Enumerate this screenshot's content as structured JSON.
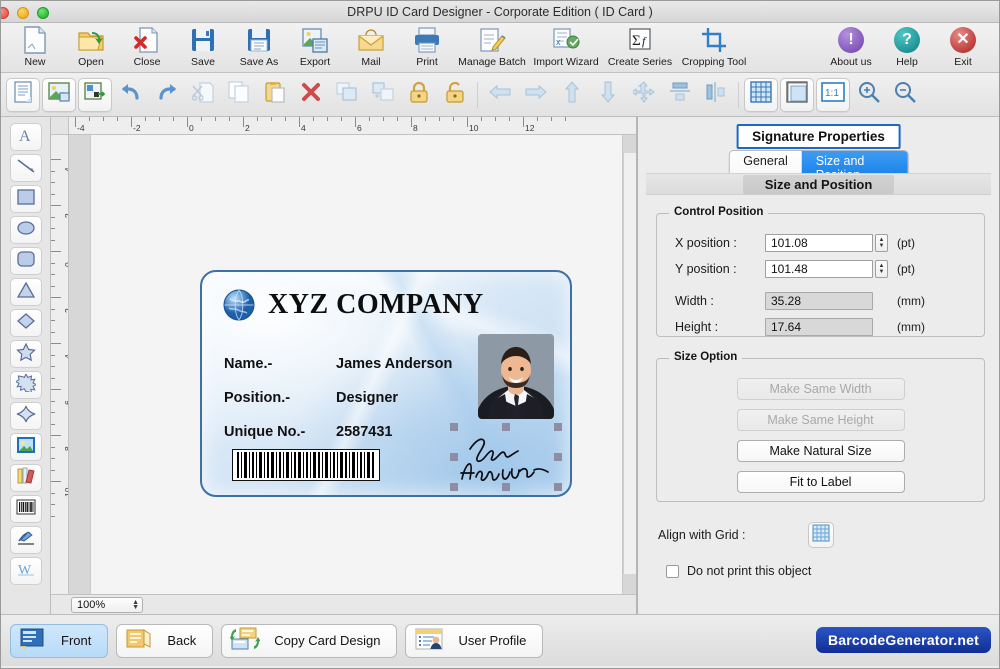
{
  "window": {
    "title": "DRPU ID Card Designer - Corporate Edition ( ID Card )",
    "traffic_lights": [
      "close",
      "minimize",
      "zoom"
    ]
  },
  "toolbar_main": {
    "items": [
      {
        "label": "New",
        "icon": "new-document-icon"
      },
      {
        "label": "Open",
        "icon": "open-folder-icon"
      },
      {
        "label": "Close",
        "icon": "close-document-icon"
      },
      {
        "label": "Save",
        "icon": "save-floppy-icon"
      },
      {
        "label": "Save As",
        "icon": "save-as-icon"
      },
      {
        "label": "Export",
        "icon": "export-icon"
      },
      {
        "label": "Mail",
        "icon": "mail-icon"
      },
      {
        "label": "Print",
        "icon": "printer-icon"
      },
      {
        "label": "Manage Batch",
        "icon": "manage-batch-icon"
      },
      {
        "label": "Import Wizard",
        "icon": "import-wizard-icon"
      },
      {
        "label": "Create Series",
        "icon": "create-series-icon"
      },
      {
        "label": "Cropping Tool",
        "icon": "cropping-tool-icon"
      }
    ],
    "right_items": [
      {
        "label": "About us",
        "icon": "info-circle-icon",
        "color": "#6c3fa8",
        "glyph": "!"
      },
      {
        "label": "Help",
        "icon": "question-circle-icon",
        "color": "#0e7d86",
        "glyph": "?"
      },
      {
        "label": "Exit",
        "icon": "exit-circle-icon",
        "color": "#ab1f1f",
        "glyph": "✕"
      }
    ]
  },
  "toolbar_second": {
    "items": [
      {
        "name": "properties-icon",
        "enabled": true
      },
      {
        "name": "background-image-icon",
        "enabled": true
      },
      {
        "name": "export-image-icon",
        "enabled": true
      },
      {
        "name": "undo-icon",
        "enabled": true
      },
      {
        "name": "redo-icon",
        "enabled": true
      },
      {
        "name": "cut-icon",
        "enabled": false
      },
      {
        "name": "copy-icon",
        "enabled": false
      },
      {
        "name": "paste-icon",
        "enabled": true
      },
      {
        "name": "delete-icon",
        "enabled": true
      },
      {
        "name": "group-icon",
        "enabled": false
      },
      {
        "name": "ungroup-icon",
        "enabled": false
      },
      {
        "name": "lock-icon",
        "enabled": true
      },
      {
        "name": "unlock-icon",
        "enabled": true
      },
      {
        "name": "align-left-icon",
        "enabled": false
      },
      {
        "name": "align-right-icon",
        "enabled": false
      },
      {
        "name": "align-top-icon",
        "enabled": false
      },
      {
        "name": "align-bottom-icon",
        "enabled": false
      },
      {
        "name": "align-center-icon",
        "enabled": false
      },
      {
        "name": "distribute-vertical-icon",
        "enabled": false
      },
      {
        "name": "distribute-horizontal-icon",
        "enabled": false
      },
      {
        "name": "show-grid-icon",
        "enabled": true
      },
      {
        "name": "page-setup-icon",
        "enabled": true
      },
      {
        "name": "actual-size-icon",
        "enabled": true,
        "label": "1:1"
      },
      {
        "name": "zoom-in-icon",
        "enabled": true
      },
      {
        "name": "zoom-out-icon",
        "enabled": true
      }
    ]
  },
  "palette": {
    "tools": [
      {
        "name": "text-tool",
        "glyph": "A"
      },
      {
        "name": "line-tool",
        "glyph": "line"
      },
      {
        "name": "rectangle-tool",
        "glyph": "rect"
      },
      {
        "name": "ellipse-tool",
        "glyph": "ellipse"
      },
      {
        "name": "rounded-rectangle-tool",
        "glyph": "roundrect"
      },
      {
        "name": "triangle-tool",
        "glyph": "triangle"
      },
      {
        "name": "diamond-tool",
        "glyph": "diamond"
      },
      {
        "name": "star-tool",
        "glyph": "star5"
      },
      {
        "name": "burst-tool",
        "glyph": "burst"
      },
      {
        "name": "four-point-star-tool",
        "glyph": "star4"
      },
      {
        "name": "image-tool",
        "glyph": "image"
      },
      {
        "name": "library-tool",
        "glyph": "books"
      },
      {
        "name": "barcode-tool",
        "glyph": "barcode"
      },
      {
        "name": "signature-tool",
        "glyph": "pen"
      },
      {
        "name": "watermark-tool",
        "glyph": "W"
      }
    ]
  },
  "canvas": {
    "zoom_value": "100%",
    "ruler_h_labels": [
      "-4",
      "-2",
      "0",
      "2",
      "4",
      "6",
      "8",
      "10",
      "12"
    ],
    "ruler_v_labels": [
      "-4",
      "-2",
      "0",
      "2",
      "4",
      "6",
      "8",
      "10"
    ],
    "card": {
      "company_name": "XYZ COMPANY",
      "rows": [
        {
          "label": "Name.-",
          "value": "James Anderson"
        },
        {
          "label": "Position.-",
          "value": "Designer"
        },
        {
          "label": "Unique No.-",
          "value": "2587431"
        }
      ],
      "signature_text": "James Anderson",
      "barcode_name": "barcode",
      "photo_name": "employee-photo"
    }
  },
  "properties": {
    "panel_title": "Signature Properties",
    "tabs": [
      {
        "label": "General",
        "active": false
      },
      {
        "label": "Size and Position",
        "active": true
      }
    ],
    "section_caption": "Size and Position",
    "control_position": {
      "legend": "Control Position",
      "fields": [
        {
          "label": "X position :",
          "value": "101.08",
          "unit": "(pt)",
          "spinner": true
        },
        {
          "label": "Y position :",
          "value": "101.48",
          "unit": "(pt)",
          "spinner": true
        },
        {
          "label": "Width :",
          "value": "35.28",
          "unit": "(mm)",
          "spinner": false
        },
        {
          "label": "Height :",
          "value": "17.64",
          "unit": "(mm)",
          "spinner": false
        }
      ]
    },
    "size_option": {
      "legend": "Size Option",
      "buttons": [
        {
          "label": "Make Same Width",
          "enabled": false
        },
        {
          "label": "Make Same Height",
          "enabled": false
        },
        {
          "label": "Make Natural Size",
          "enabled": true
        },
        {
          "label": "Fit to Label",
          "enabled": true
        }
      ]
    },
    "align_with_grid_label": "Align with Grid :",
    "do_not_print_label": "Do not print this object",
    "do_not_print_checked": false
  },
  "bottombar": {
    "buttons": [
      {
        "label": "Front",
        "icon": "card-front-icon",
        "active": true
      },
      {
        "label": "Back",
        "icon": "card-back-icon",
        "active": false
      },
      {
        "label": "Copy Card Design",
        "icon": "copy-card-icon",
        "active": false
      },
      {
        "label": "User Profile",
        "icon": "user-profile-icon",
        "active": false
      }
    ],
    "brand": "BarcodeGenerator.net"
  },
  "colors": {
    "accent_blue": "#0f7ae5",
    "panel_border": "#1a68c9",
    "brand_bg": "#102f93",
    "card_border": "#3d6fa8"
  }
}
